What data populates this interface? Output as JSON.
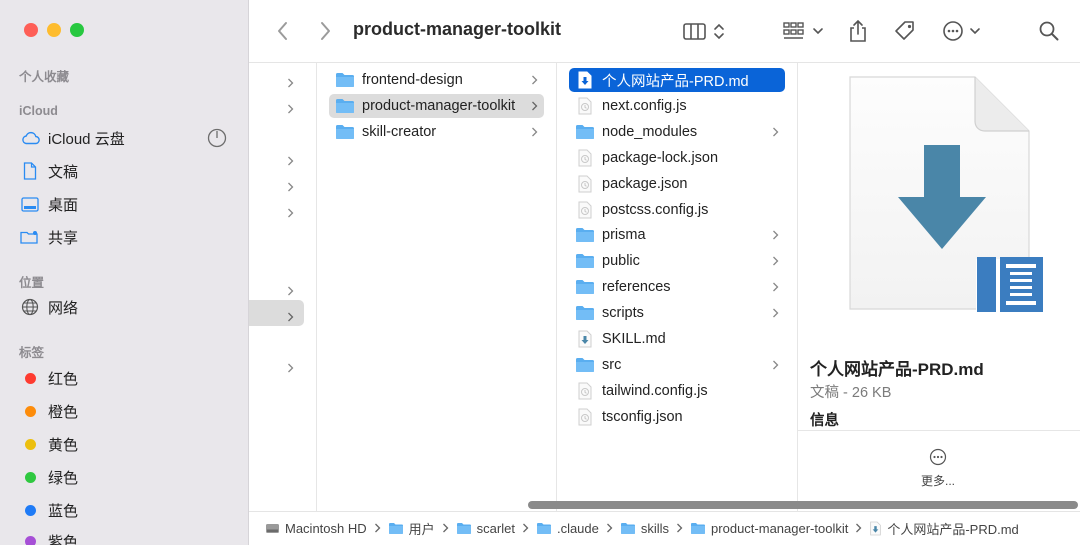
{
  "window": {
    "title": "product-manager-toolkit"
  },
  "sidebar": {
    "favorites_heading": "个人收藏",
    "icloud_heading": "iCloud",
    "icloud_items": [
      {
        "label": "iCloud 云盘",
        "icon": "cloud-icon"
      },
      {
        "label": "文稿",
        "icon": "document-icon"
      },
      {
        "label": "桌面",
        "icon": "desktop-icon"
      },
      {
        "label": "共享",
        "icon": "shared-folder-icon"
      }
    ],
    "locations_heading": "位置",
    "location_items": [
      {
        "label": "网络",
        "icon": "globe-icon"
      }
    ],
    "tags_heading": "标签",
    "tags": [
      {
        "label": "红色",
        "color": "#fe3b30"
      },
      {
        "label": "橙色",
        "color": "#fd8c0a"
      },
      {
        "label": "黄色",
        "color": "#ecbf0e"
      },
      {
        "label": "绿色",
        "color": "#2fc840"
      },
      {
        "label": "蓝色",
        "color": "#1f7bf6"
      },
      {
        "label": "紫色",
        "color": "#a64fd6"
      }
    ]
  },
  "column1": [
    {
      "label": "frontend-design",
      "kind": "folder"
    },
    {
      "label": "product-manager-toolkit",
      "kind": "folder",
      "selected": true
    },
    {
      "label": "skill-creator",
      "kind": "folder"
    }
  ],
  "column2": [
    {
      "label": "个人网站产品-PRD.md",
      "kind": "md",
      "selected": true
    },
    {
      "label": "next.config.js",
      "kind": "file"
    },
    {
      "label": "node_modules",
      "kind": "folder"
    },
    {
      "label": "package-lock.json",
      "kind": "file"
    },
    {
      "label": "package.json",
      "kind": "file"
    },
    {
      "label": "postcss.config.js",
      "kind": "file"
    },
    {
      "label": "prisma",
      "kind": "folder"
    },
    {
      "label": "public",
      "kind": "folder"
    },
    {
      "label": "references",
      "kind": "folder"
    },
    {
      "label": "scripts",
      "kind": "folder"
    },
    {
      "label": "SKILL.md",
      "kind": "md"
    },
    {
      "label": "src",
      "kind": "folder"
    },
    {
      "label": "tailwind.config.js",
      "kind": "file"
    },
    {
      "label": "tsconfig.json",
      "kind": "file"
    }
  ],
  "preview": {
    "name": "个人网站产品-PRD.md",
    "kind": "文稿 - 26 KB",
    "info_heading": "信息",
    "more_label": "更多..."
  },
  "pathbar": [
    {
      "label": "Macintosh HD",
      "icon": "hard-drive-icon"
    },
    {
      "label": "用户",
      "icon": "folder-icon"
    },
    {
      "label": "scarlet",
      "icon": "home-folder-icon"
    },
    {
      "label": ".claude",
      "icon": "folder-icon"
    },
    {
      "label": "skills",
      "icon": "folder-icon"
    },
    {
      "label": "product-manager-toolkit",
      "icon": "folder-icon"
    },
    {
      "label": "个人网站产品-PRD.md",
      "icon": "markdown-file-icon"
    }
  ],
  "colors": {
    "selection": "#0a64d8",
    "folder": "#5aaef0"
  }
}
